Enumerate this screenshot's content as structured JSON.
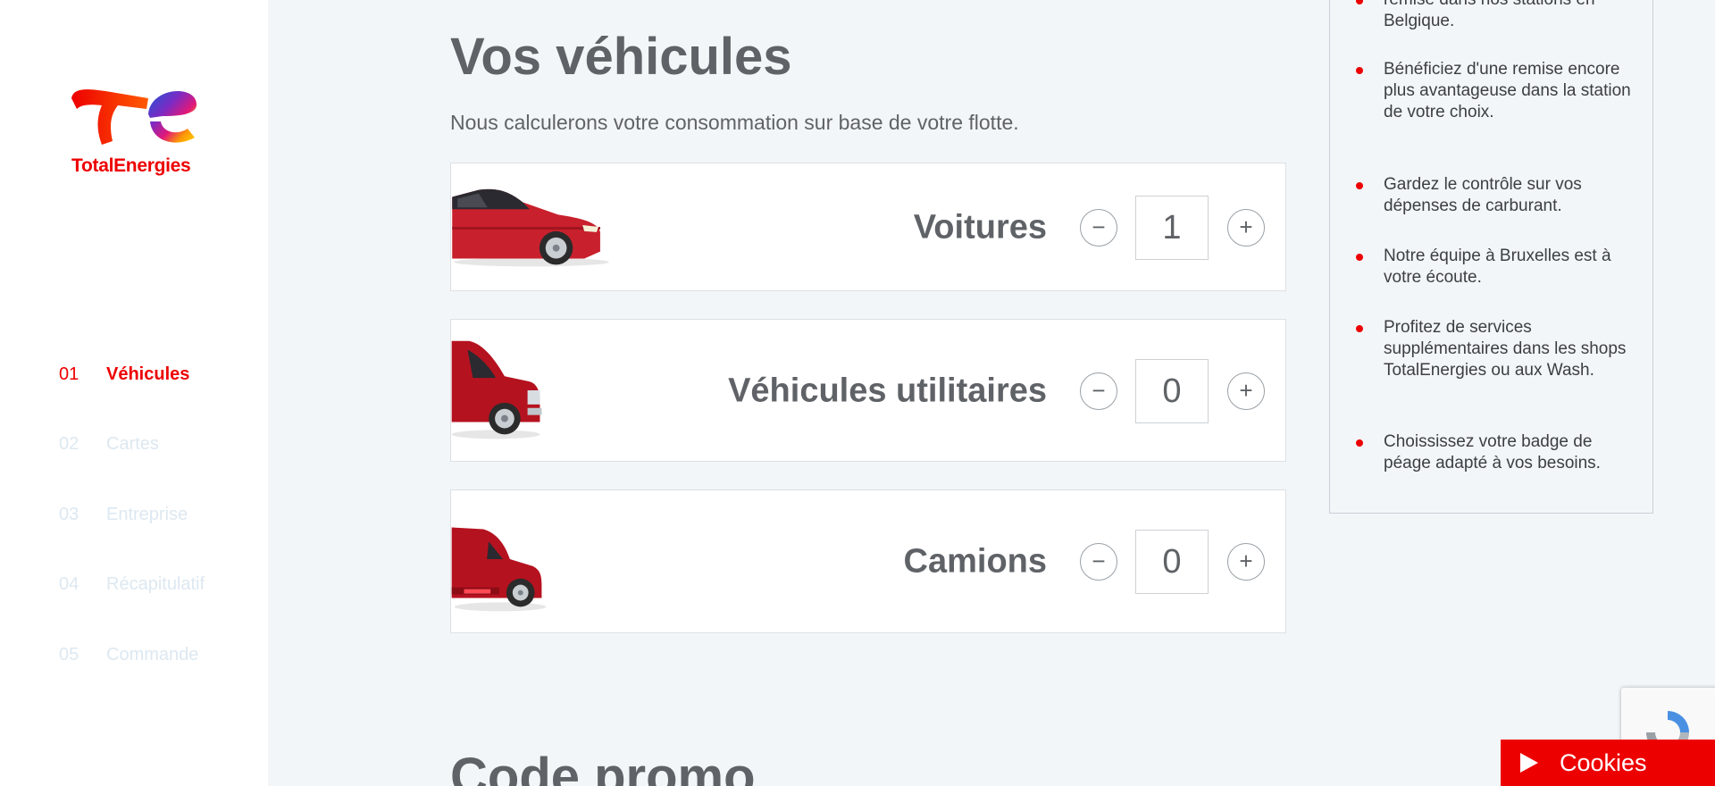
{
  "brand": {
    "name": "TotalEnergies",
    "primary_color": "#ed0000"
  },
  "steps": [
    {
      "num": "01",
      "label": "Véhicules",
      "state": "active"
    },
    {
      "num": "02",
      "label": "Cartes",
      "state": "inactive"
    },
    {
      "num": "03",
      "label": "Entreprise",
      "state": "inactive"
    },
    {
      "num": "04",
      "label": "Récapitulatif",
      "state": "inactive"
    },
    {
      "num": "05",
      "label": "Commande",
      "state": "inactive"
    }
  ],
  "main": {
    "title": "Vos véhicules",
    "subtitle": "Nous calculerons votre consommation sur base de votre flotte.",
    "vehicles": [
      {
        "label": "Voitures",
        "count": "1",
        "minus": "−",
        "plus": "+",
        "icon": "car-icon"
      },
      {
        "label": "Véhicules utilitaires",
        "count": "0",
        "minus": "−",
        "plus": "+",
        "icon": "van-icon"
      },
      {
        "label": "Camions",
        "count": "0",
        "minus": "−",
        "plus": "+",
        "icon": "truck-icon"
      }
    ],
    "promo_title": "Code promo"
  },
  "benefits": {
    "items": [
      "remise dans nos stations en Belgique.",
      "Bénéficiez d'une remise encore plus avantageuse dans la station de votre choix.",
      "Gardez le contrôle sur vos dépenses de carburant.",
      "Notre équipe à Bruxelles est à votre écoute.",
      "Profitez de services supplémentaires dans les shops TotalEnergies ou aux Wash.",
      "Choississez votre badge de péage adapté à vos besoins."
    ]
  },
  "cookies": {
    "label": "Cookies"
  }
}
